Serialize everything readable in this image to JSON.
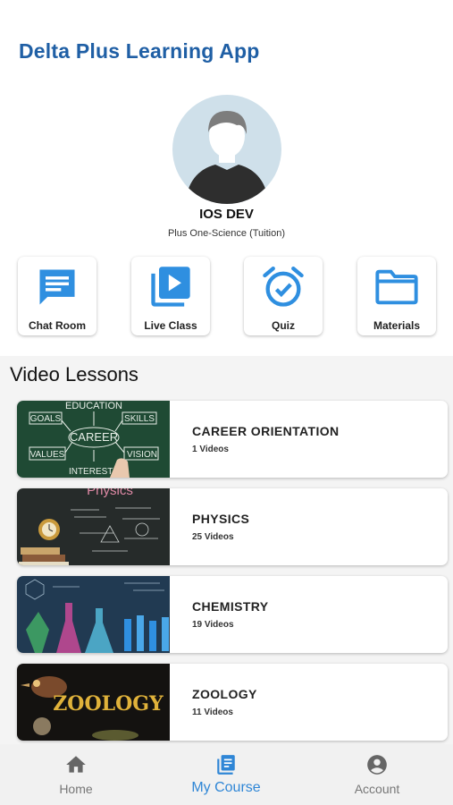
{
  "app": {
    "title": "Delta Plus Learning App"
  },
  "user": {
    "name": "IOS DEV",
    "course": "Plus One-Science (Tuition)"
  },
  "quick_actions": [
    {
      "label": "Chat Room",
      "icon": "chat-icon"
    },
    {
      "label": "Live Class",
      "icon": "video-library-icon"
    },
    {
      "label": "Quiz",
      "icon": "alarm-check-icon"
    },
    {
      "label": "Materials",
      "icon": "folder-icon"
    }
  ],
  "video_lessons": {
    "title": "Video Lessons",
    "items": [
      {
        "title": "CAREER ORIENTATION",
        "count": "1 Videos",
        "thumb_text": [
          "EDUCATION",
          "GOALS",
          "SKILLS",
          "CAREER",
          "VALUES",
          "VISION",
          "INTERESTS"
        ]
      },
      {
        "title": "PHYSICS",
        "count": "25 Videos",
        "thumb_text": [
          "Physics"
        ]
      },
      {
        "title": "CHEMISTRY",
        "count": "19 Videos",
        "thumb_text": []
      },
      {
        "title": "ZOOLOGY",
        "count": "11 Videos",
        "thumb_text": [
          "ZOOLOGY"
        ]
      }
    ]
  },
  "bottom_nav": [
    {
      "label": "Home",
      "icon": "home-icon",
      "active": false
    },
    {
      "label": "My Course",
      "icon": "book-icon",
      "active": true
    },
    {
      "label": "Account",
      "icon": "account-circle-icon",
      "active": false
    }
  ],
  "colors": {
    "accent": "#2f86d6",
    "title": "#1f5fa5",
    "icon_blue": "#2f8fe0"
  }
}
